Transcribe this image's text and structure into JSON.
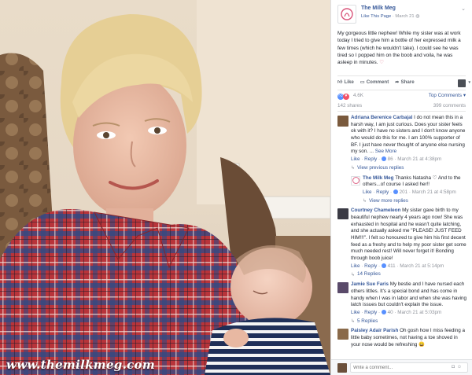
{
  "photo": {
    "watermark": "www.themilkmeg.com"
  },
  "post": {
    "page_name": "The Milk Meg",
    "like_page_label": "Like This Page",
    "date": "March 21",
    "text": "My gorgeous little nephew! While my sister was at work today I tried to give him a bottle of her expressed milk a few times (which he wouldn't take). I could see he was tired so I popped him on the boob and voila, he was asleep in minutes.",
    "heart_glyph": "♡",
    "actions": {
      "like": "Like",
      "comment": "Comment",
      "share": "Share"
    },
    "reaction_count": "4.6K",
    "top_comments_label": "Top Comments",
    "shares": "142 shares",
    "comment_count": "399 comments"
  },
  "comments": [
    {
      "name": "Adriana Berenice Carbajal",
      "text": "I do not mean this in a harsh way, I am just curious. Does your sister feels ok with it? I have no sisters and I don't know anyone who would do this for me. I am 100% supporter of BF. I just have never thought of anyone else nursing my son.",
      "see_more": "See More",
      "like": "Like",
      "reply": "Reply",
      "likes": "86",
      "time": "March 21 at 4:38pm",
      "replies_link": "View previous replies",
      "avatar_color": "#7a5a3d"
    },
    {
      "name": "The Milk Meg",
      "text": "Thanks Natasha ♡ And to the others...of course I asked her!!",
      "like": "Like",
      "reply": "Reply",
      "likes": "201",
      "time": "March 21 at 4:58pm",
      "replies_link": "View more replies"
    },
    {
      "name": "Courtney Chameleon",
      "text": "My sister gave birth to my beautiful nephew nearly 4 years ago now! She was exhausted in hospital and he wasn't quite latching, and she actually asked me \"PLEASE! JUST FEED HIM!!!\". I felt so honoured to give him his first decent feed as a freshy and to help my poor sister get some much needed rest! Will never forget it! Bonding through boob juice!",
      "like": "Like",
      "reply": "Reply",
      "likes": "411",
      "time": "March 21 at 5:14pm",
      "replies_link": "14 Replies",
      "avatar_color": "#3b3b45"
    },
    {
      "name": "Jamie Sue Faris",
      "text": "My bestie and I have nursed each others littles. It's a special bond and has come in handy when I was in labor and when she was having latch issues but couldn't explain the issue.",
      "like": "Like",
      "reply": "Reply",
      "likes": "40",
      "time": "March 21 at 5:03pm",
      "replies_link": "5 Replies",
      "avatar_color": "#5a4a6a"
    },
    {
      "name": "Paisley Adair Parish",
      "text": "Oh gosh how I miss feeding a little baby sometimes, not having a toe shoved in your nose would be refreshing 😄",
      "avatar_color": "#8a6a4a"
    }
  ],
  "write_comment": {
    "placeholder": "Write a comment..."
  },
  "colors": {
    "facebook_link": "#365899",
    "like_blue": "#5890ff",
    "love_red": "#f25268",
    "shirt_red": "#b8343a",
    "shirt_blue": "#3a5a9c"
  }
}
